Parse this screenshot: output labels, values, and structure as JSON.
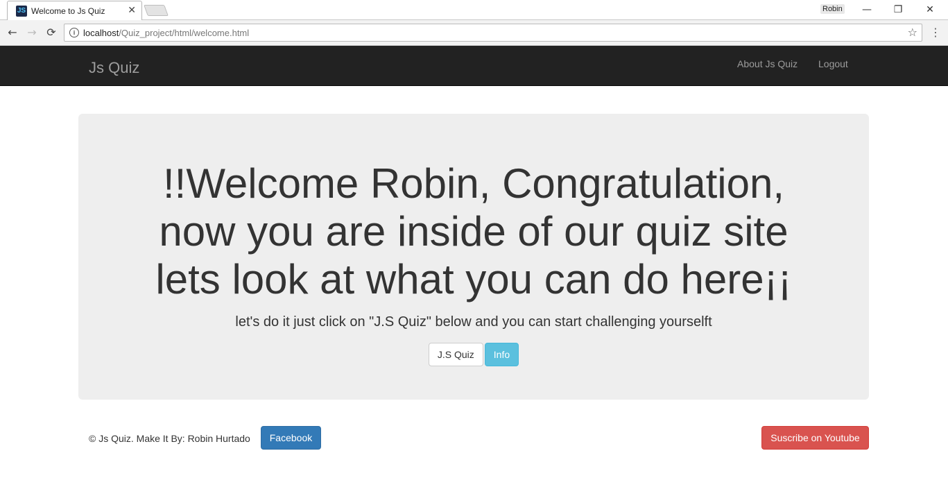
{
  "browser": {
    "tab": {
      "title": "Welcome to Js Quiz",
      "favicon_text": "JS",
      "close_glyph": "✕"
    },
    "profile_name": "Robin",
    "window_controls": {
      "minimize": "—",
      "restore": "❐",
      "close": "✕"
    },
    "nav": {
      "back": "←",
      "forward": "→",
      "reload": "⟳"
    },
    "address": {
      "host": "localhost",
      "path": "/Quiz_project/html/welcome.html",
      "info_glyph": "i"
    },
    "star_glyph": "☆",
    "menu_glyph": "⋮"
  },
  "navbar": {
    "brand": "Js Quiz",
    "links": [
      "About Js Quiz",
      "Logout"
    ],
    "background": "#222222",
    "link_color": "#9d9d9d"
  },
  "jumbotron": {
    "title_lines": [
      "!!Welcome Robin, Congratulation,",
      "now you are inside of our quiz site",
      "lets look at what you can do here¡¡"
    ],
    "subtitle": "let's do it just click on \"J.S Quiz\" below and you can start challenging yourselft",
    "buttons": {
      "quiz": "J.S Quiz",
      "info": "Info"
    },
    "background": "#eeeeee"
  },
  "footer": {
    "copyright": "© Js Quiz. Make It By: Robin Hurtado",
    "facebook_button": "Facebook",
    "youtube_button": "Suscribe on Youtube",
    "colors": {
      "facebook": "#337ab7",
      "youtube": "#d9534f",
      "info": "#5bc0de"
    }
  }
}
